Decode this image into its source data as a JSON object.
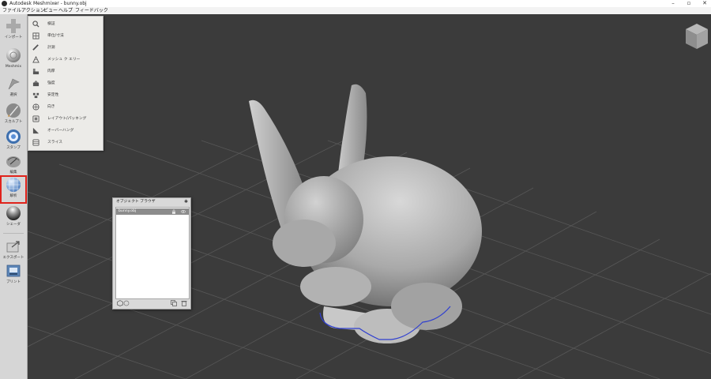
{
  "window": {
    "title": "Autodesk Meshmixer - bunny.obj",
    "minimize": "–",
    "maximize": "▫",
    "close": "✕"
  },
  "menubar": [
    "ファイル",
    "アクション",
    "ビュー",
    "ヘルプ",
    "フィードバック"
  ],
  "sidebar": {
    "tools": [
      {
        "label": "インポート",
        "icon": "import-plus-icon"
      },
      {
        "label": "Meshmix",
        "icon": "meshmix-sphere-icon"
      },
      {
        "label": "選択",
        "icon": "select-arrow-icon"
      },
      {
        "label": "スカルプト",
        "icon": "sculpt-brush-icon"
      },
      {
        "label": "スタンプ",
        "icon": "stamp-icon"
      },
      {
        "label": "編集",
        "icon": "edit-icon"
      },
      {
        "label": "解析",
        "icon": "analysis-sphere-icon",
        "selected": true
      },
      {
        "label": "シェーダ",
        "icon": "shader-sphere-icon"
      },
      {
        "label": "エクスポート",
        "icon": "export-icon"
      },
      {
        "label": "プリント",
        "icon": "print-icon"
      }
    ]
  },
  "analysis_menu": {
    "items": [
      {
        "label": "検証",
        "icon": "inspector-magnifier-icon"
      },
      {
        "label": "単位/寸法",
        "icon": "units-dimensions-icon"
      },
      {
        "label": "計測",
        "icon": "measure-ruler-icon"
      },
      {
        "label": "メッシュ ク エリー",
        "icon": "mesh-query-icon"
      },
      {
        "label": "肉厚",
        "icon": "thickness-icon"
      },
      {
        "label": "強度",
        "icon": "strength-icon"
      },
      {
        "label": "安定性",
        "icon": "stability-icon"
      },
      {
        "label": "向き",
        "icon": "orientation-icon"
      },
      {
        "label": "レイアウト/パッキング",
        "icon": "layout-packing-icon"
      },
      {
        "label": "オーバーハング",
        "icon": "overhangs-icon"
      },
      {
        "label": "スライス",
        "icon": "slice-icon"
      }
    ]
  },
  "object_browser": {
    "title": "オブジェクト ブラウザ",
    "objects": [
      {
        "name": "bunny.obj",
        "selected": true
      }
    ]
  },
  "colors": {
    "viewport_bg": "#3b3b3b",
    "grid": "#575757",
    "selection_outline": "#e0231c",
    "mesh_base": "#b7b7b7",
    "boundary_edge": "#2f3fd0"
  }
}
